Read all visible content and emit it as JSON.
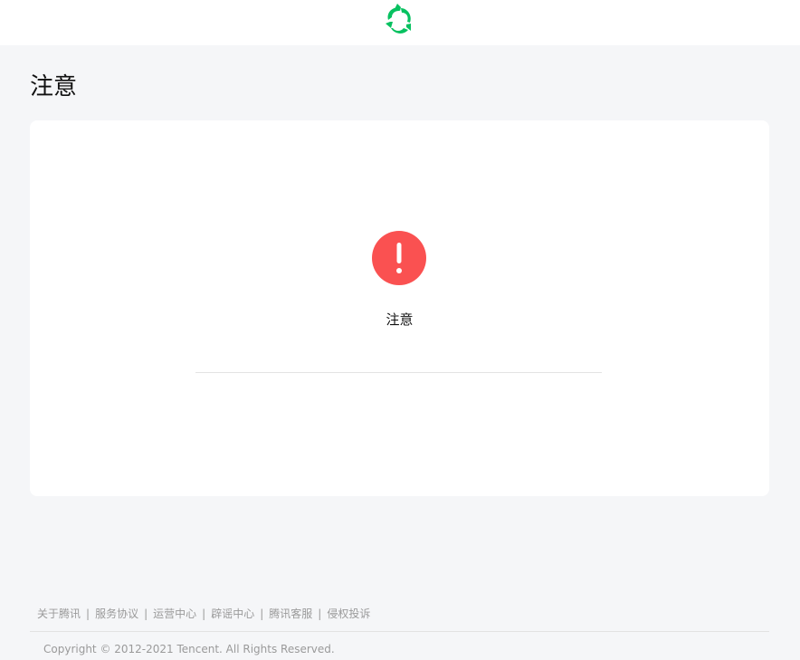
{
  "header": {
    "logo_icon": "wechat-green-swirl-logo",
    "brand_color": "#07c160"
  },
  "page": {
    "title": "注意"
  },
  "message": {
    "icon": "exclamation-circle-icon",
    "icon_color": "#fa5151",
    "text": "注意"
  },
  "footer": {
    "links": [
      "关于腾讯",
      "服务协议",
      "运营中心",
      "辟谣中心",
      "腾讯客服",
      "侵权投诉"
    ],
    "separator": "|",
    "copyright": "Copyright © 2012-2021 Tencent. All Rights Reserved."
  }
}
